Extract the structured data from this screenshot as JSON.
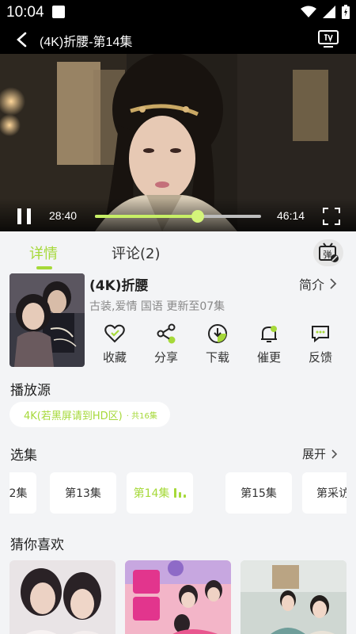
{
  "status_bar": {
    "time": "10:04"
  },
  "header": {
    "title": "(4K)折腰-第14集"
  },
  "player": {
    "current_time": "28:40",
    "total_time": "46:14",
    "progress": 0.62
  },
  "tabs": [
    {
      "label": "详情"
    },
    {
      "label": "评论(2)"
    }
  ],
  "show": {
    "title": "(4K)折腰",
    "meta": "古装,爱情 国语 更新至07集",
    "intro_label": "简介"
  },
  "actions": [
    {
      "label": "收藏",
      "icon": "heart-icon"
    },
    {
      "label": "分享",
      "icon": "share-icon"
    },
    {
      "label": "下载",
      "icon": "download-icon"
    },
    {
      "label": "催更",
      "icon": "bell-icon"
    },
    {
      "label": "反馈",
      "icon": "feedback-icon"
    }
  ],
  "source": {
    "section_title": "播放源",
    "name": "4K(若黑屏请到HD区)",
    "count": "· 共16集"
  },
  "episodes": {
    "section_title": "选集",
    "expand_label": "展开",
    "items": [
      {
        "label": "2集"
      },
      {
        "label": "第13集"
      },
      {
        "label": "第14集"
      },
      {
        "label": "第15集"
      },
      {
        "label": "第采访"
      }
    ]
  },
  "recommend": {
    "section_title": "猜你喜欢"
  },
  "colors": {
    "accent": "#a6d93a",
    "background": "#f3f4f6"
  }
}
